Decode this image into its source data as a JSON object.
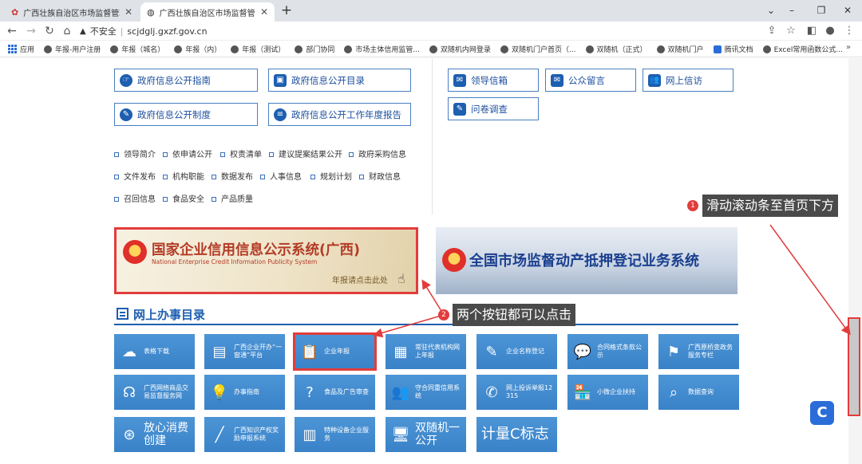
{
  "browser": {
    "tabs": [
      {
        "title": "广西壮族自治区市场监督管理局网",
        "active": false
      },
      {
        "title": "广西壮族自治区市场监督管理局网",
        "active": true
      }
    ],
    "new_tab_label": "+",
    "insecure_label": "不安全",
    "url": "scjdglj.gxzf.gov.cn",
    "bookmarks": [
      "应用",
      "年报-用户注册",
      "年报（城名）",
      "年报（内）",
      "年报（测试）",
      "部门协同",
      "市场主体信用监管...",
      "双随机内网登录",
      "双随机门户首页（...",
      "双随机（正式）",
      "双随机门户",
      "腾讯文档",
      "Excel常用函数公式..."
    ],
    "bookmarks_more": "»"
  },
  "page": {
    "left_buttons": [
      {
        "label": "政府信息公开指南",
        "icon": "hand-icon"
      },
      {
        "label": "政府信息公开目录",
        "icon": "monitor-icon"
      },
      {
        "label": "政府信息公开制度",
        "icon": "pen-icon"
      },
      {
        "label": "政府信息公开工作年度报告",
        "icon": "list-icon"
      }
    ],
    "right_buttons": [
      {
        "label": "领导信箱",
        "icon": "mail-icon"
      },
      {
        "label": "公众留言",
        "icon": "mail-icon"
      },
      {
        "label": "网上信访",
        "icon": "people-icon"
      },
      {
        "label": "问卷调查",
        "icon": "edit-icon"
      }
    ],
    "links_row1": [
      "领导简介",
      "依申请公开",
      "权责清单",
      "建议提案结果公开",
      "政府采购信息"
    ],
    "links_row2": [
      "文件发布",
      "机构职能",
      "数据发布",
      "人事信息",
      "规划计划",
      "财政信息"
    ],
    "links_row3": [
      "召回信息",
      "食品安全",
      "产品质量"
    ],
    "banner1": {
      "title": "国家企业信用信息公示系统(广西)",
      "subtitle": "National Enterprise Credit Information Publicity System",
      "cta": "年报请点击此处"
    },
    "banner2": {
      "title": "全国市场监督动产抵押登记业务系统"
    },
    "section_title": "网上办事目录",
    "tiles_row1": [
      "表格下载",
      "广西企业开办“一窗通”平台",
      "企业年报",
      "常驻代表机构网上年报",
      "企业名称登记",
      "合同格式条款公示",
      "广西原桥变政务服务专栏"
    ],
    "tiles_row2": [
      "广西网络商品交易监督服务网",
      "办事指南",
      "食品及广告审查",
      "守合同重信用系统",
      "网上投诉举报12315",
      "小微企业扶持",
      "数据查询"
    ],
    "tiles_row3": [
      "放心消费创建",
      "广西知识产权奖励申报系统",
      "特种设备企业服务",
      "双随机一公开",
      "计量C标志"
    ]
  },
  "annotations": [
    {
      "num": "1",
      "text": "滑动滚动条至首页下方"
    },
    {
      "num": "2",
      "text": "两个按钮都可以点击"
    }
  ],
  "colors": {
    "accent": "#1d5fb0",
    "highlight": "#e33c3c",
    "tile": "#3f88cc"
  }
}
